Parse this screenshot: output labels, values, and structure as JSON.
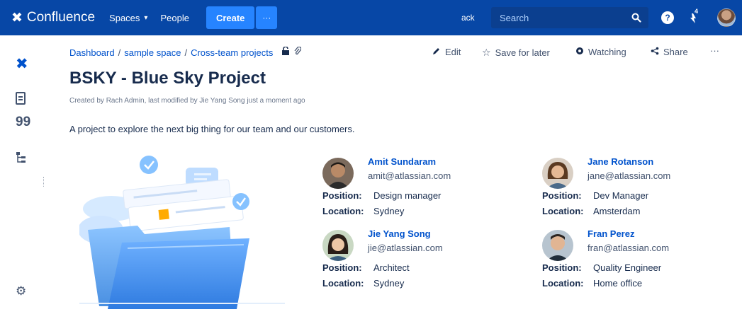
{
  "topbar": {
    "brand": "Confluence",
    "spaces": "Spaces",
    "people": "People",
    "create": "Create",
    "more": "···",
    "feedback": "ack",
    "search_placeholder": "Search",
    "help": "?",
    "notifications_count": "4",
    "colors": {
      "bar": "#0747A6",
      "create": "#2684FF"
    }
  },
  "sidebar": {
    "icons": [
      "confluence-logo-icon",
      "pages-icon",
      "blog-quote-icon",
      "page-tree-icon",
      "settings-gear-icon"
    ]
  },
  "breadcrumb": {
    "items": [
      "Dashboard",
      "sample space",
      "Cross-team projects"
    ],
    "separator": "/"
  },
  "actions": {
    "edit": "Edit",
    "save_for_later": "Save for later",
    "watching": "Watching",
    "share": "Share",
    "more": "···"
  },
  "page": {
    "title": "BSKY - Blue Sky Project",
    "byline": "Created by Rach Admin, last modified by Jie Yang Song just a moment ago",
    "intro": "A project to explore the next big thing for our team and our customers."
  },
  "team": [
    {
      "name": "Amit Sundaram",
      "email": "amit@atlassian.com",
      "position_label": "Position:",
      "position": "Design manager",
      "location_label": "Location:",
      "location": "Sydney"
    },
    {
      "name": "Jane Rotanson",
      "email": "jane@atlassian.com",
      "position_label": "Position:",
      "position": "Dev Manager",
      "location_label": "Location:",
      "location": "Amsterdam"
    },
    {
      "name": "Jie Yang Song",
      "email": "jie@atlassian.com",
      "position_label": "Position:",
      "position": "Architect",
      "location_label": "Location:",
      "location": "Sydney"
    },
    {
      "name": "Fran Perez",
      "email": "fran@atlassian.com",
      "position_label": "Position:",
      "position": "Quality Engineer",
      "location_label": "Location:",
      "location": "Home office"
    }
  ]
}
